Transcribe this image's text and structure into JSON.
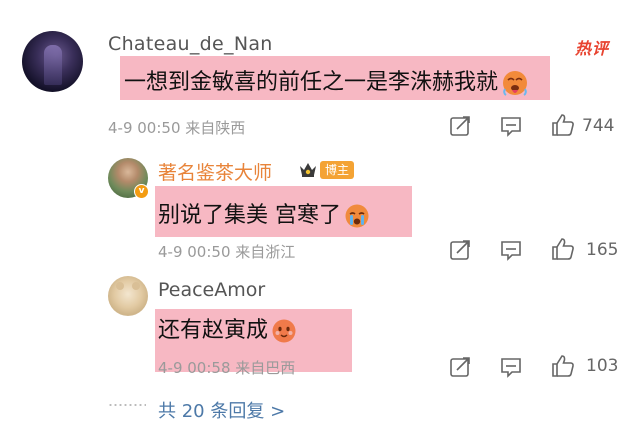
{
  "header": {
    "hot_badge": "热评"
  },
  "main_comment": {
    "username": "Chateau_de_Nan",
    "text": "一想到金敏喜的前任之一是李洙赫我就",
    "meta": "4-9 00:50 来自陕西",
    "like_count": "744"
  },
  "replies": [
    {
      "username": "著名鉴茶大师",
      "badge": "博主",
      "text": "别说了集美 宫寒了",
      "meta": "4-9 00:50 来自浙江",
      "like_count": "165"
    },
    {
      "username": "PeaceAmor",
      "text": "还有赵寅成",
      "meta": "4-9 00:58 来自巴西",
      "like_count": "103"
    }
  ],
  "more_replies": "共 20 条回复 >",
  "colors": {
    "highlight": "#f7b8c3",
    "link": "#4d79a8",
    "bozhu": "#f4a334",
    "hot": "#e8432f"
  }
}
